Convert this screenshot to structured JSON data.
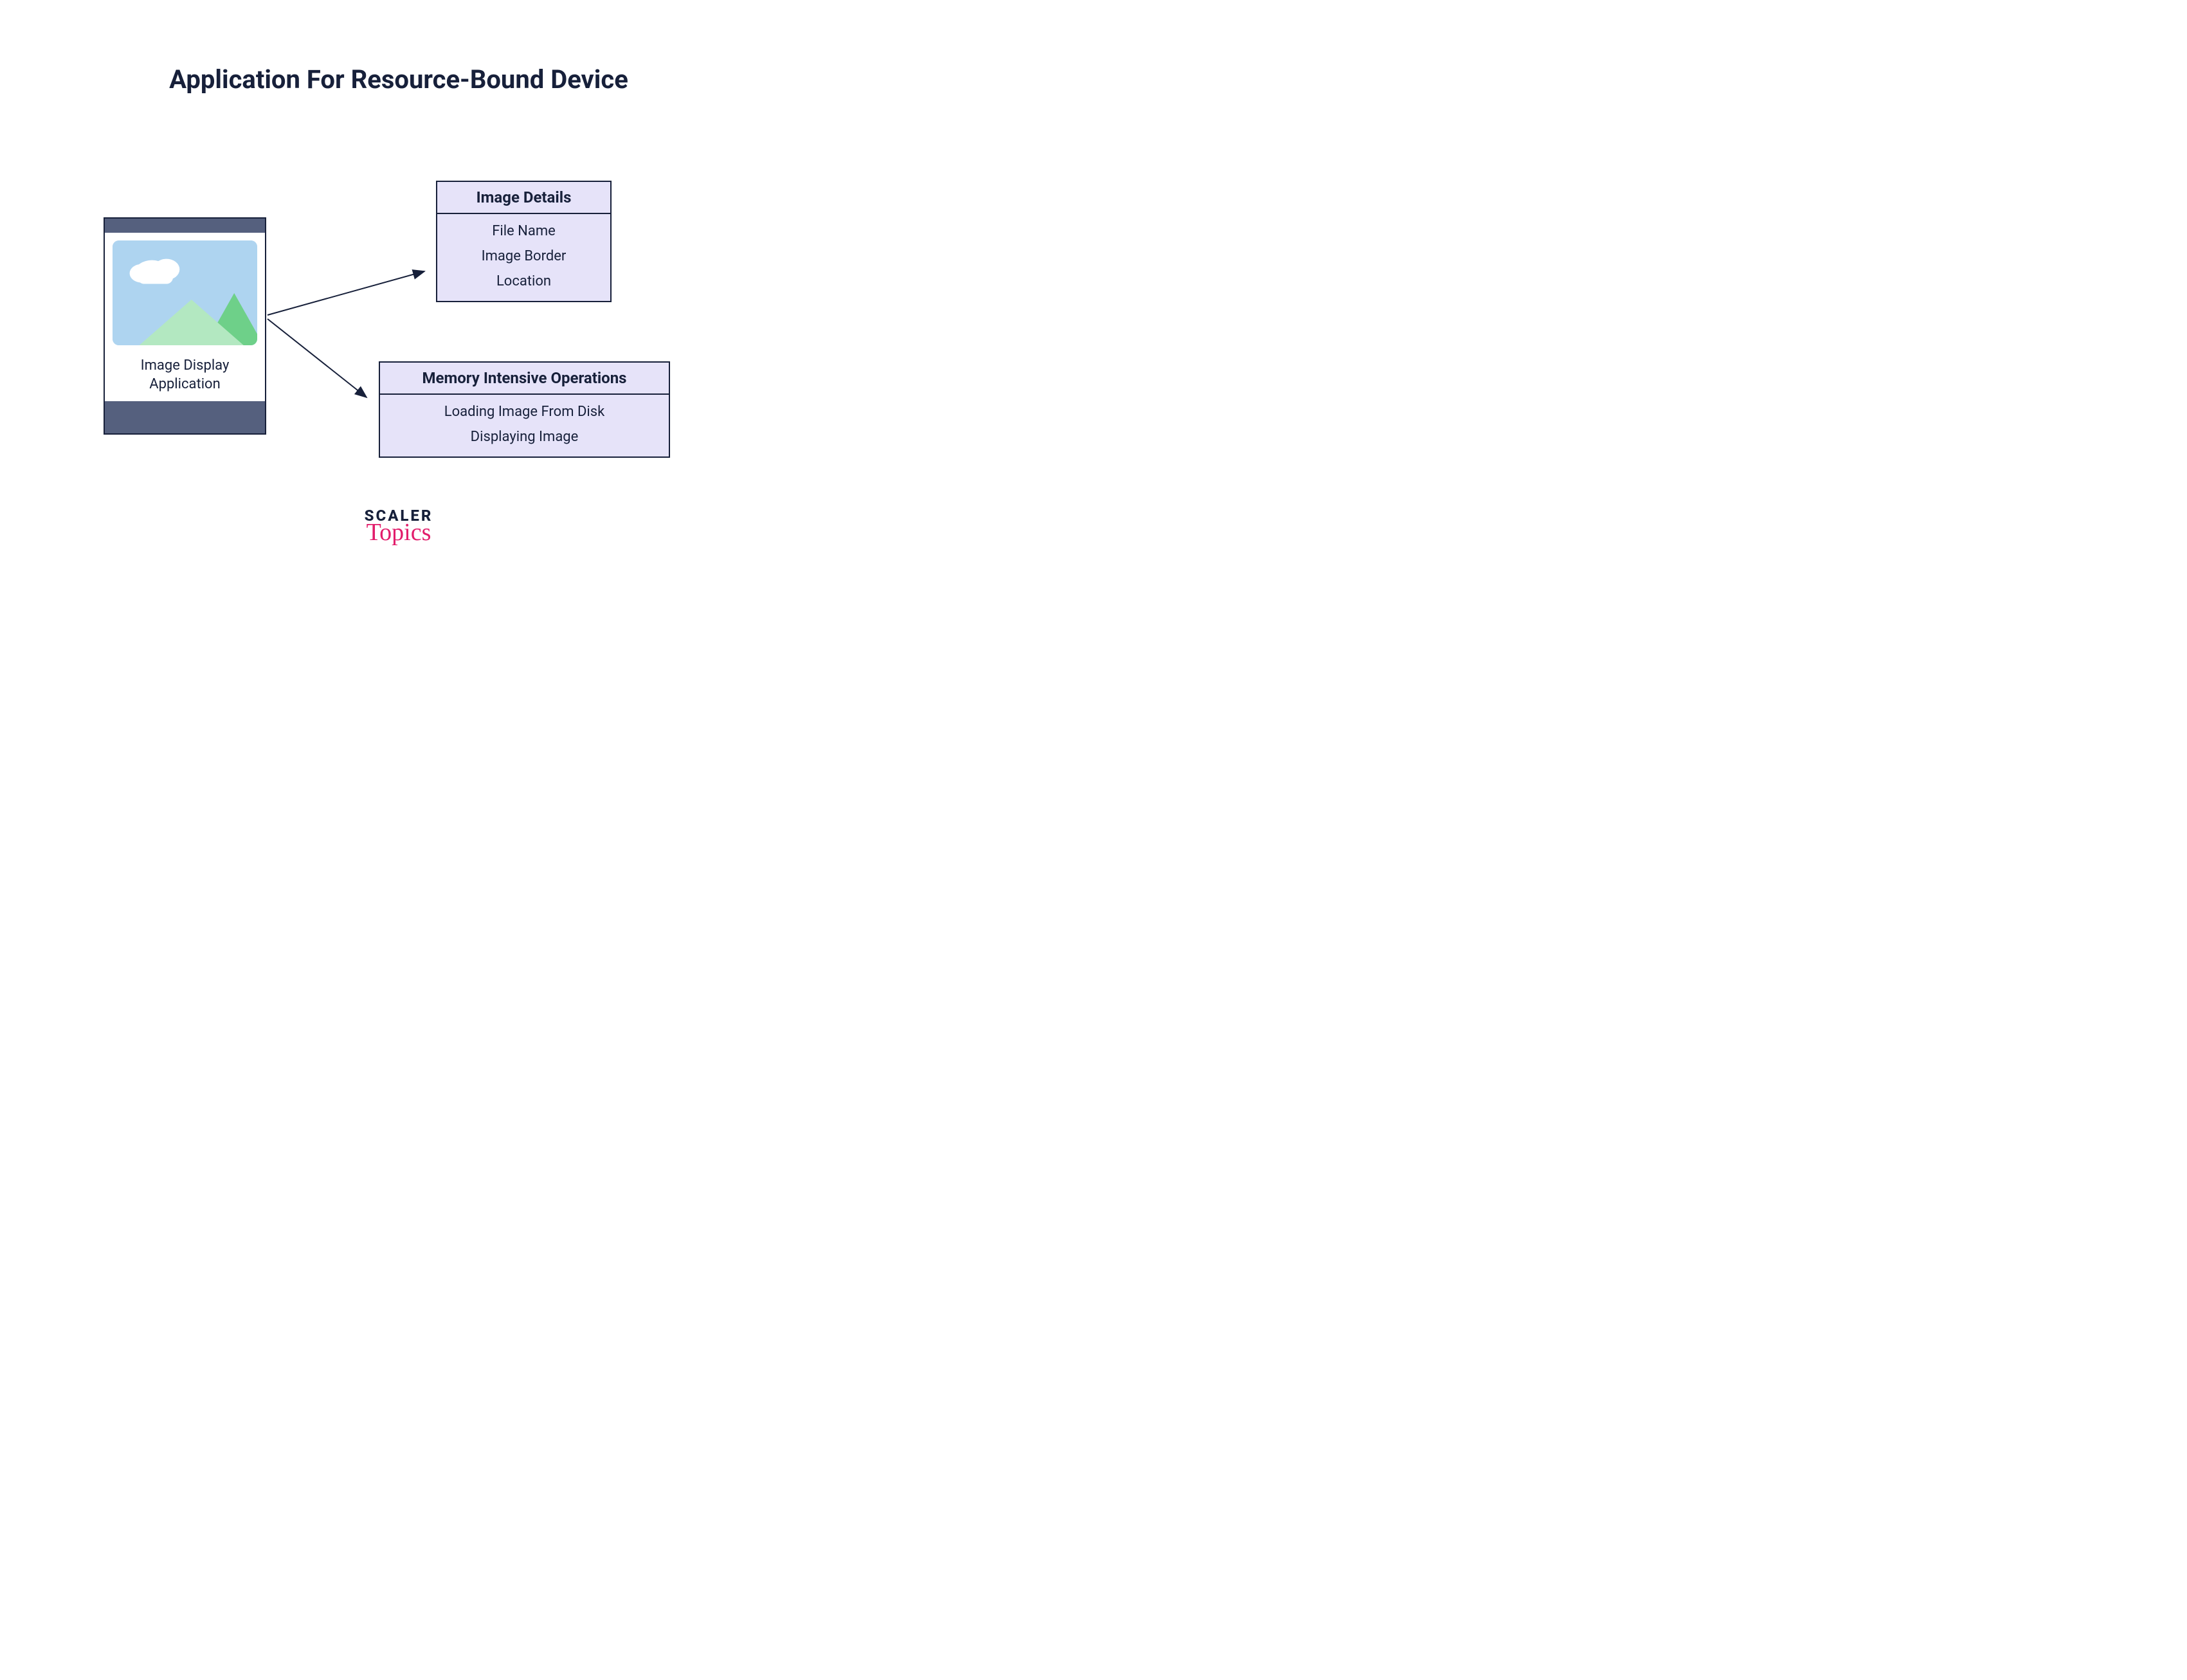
{
  "title": "Application For Resource-Bound Device",
  "device": {
    "label": "Image Display\nApplication"
  },
  "panels": {
    "details": {
      "header": "Image Details",
      "items": [
        "File Name",
        "Image Border",
        "Location"
      ]
    },
    "memops": {
      "header": "Memory Intensive Operations",
      "items": [
        "Loading Image From Disk",
        "Displaying Image"
      ]
    }
  },
  "logo": {
    "line1": "SCALER",
    "line2": "Topics"
  },
  "colors": {
    "dark": "#17203a",
    "deviceFrame": "#55607e",
    "panelFill": "#e6e3f9",
    "sky": "#aed4f0",
    "mountainDark": "#6ed089",
    "mountainLight": "#b3e8c1",
    "accent": "#e21d6b"
  }
}
